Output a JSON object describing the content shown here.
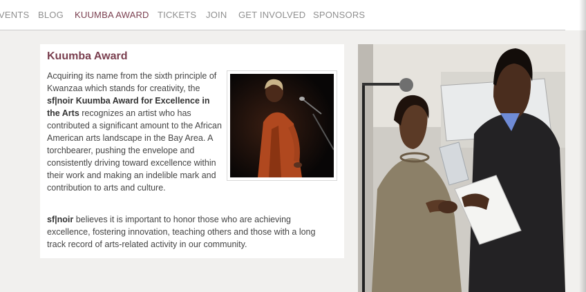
{
  "nav": {
    "items": [
      {
        "label": "VENTS",
        "active": false
      },
      {
        "label": "BLOG",
        "active": false
      },
      {
        "label": "KUUMBA AWARD",
        "active": true
      },
      {
        "label": "TICKETS",
        "active": false
      },
      {
        "label": "JOIN",
        "active": false
      },
      {
        "label": "GET INVOLVED",
        "active": false
      },
      {
        "label": "SPONSORS",
        "active": false
      }
    ]
  },
  "award": {
    "title": "Kuumba Award",
    "intro_before": "Acquiring its name from the sixth principle of Kwanzaa which stands for creativity, the ",
    "intro_bold": "sf|noir Kuumba Award for Excellence in the Arts",
    "intro_after": " recognizes an artist who has contributed a significant amount to the African American arts landscape in the Bay Area. A torchbearer, pushing the envelope and consistently driving toward excellence within their work and making an indelible mark and contribution to arts and culture.",
    "para2_bold": "sf|noir",
    "para2_rest": " believes it is important to honor those who are achieving excellence, fostering innovation, teaching others and those with a long track record of arts-related activity in our community."
  },
  "colors": {
    "accent": "#7a3f4f",
    "nav_text": "#8f8f8f",
    "body_text": "#444444"
  }
}
